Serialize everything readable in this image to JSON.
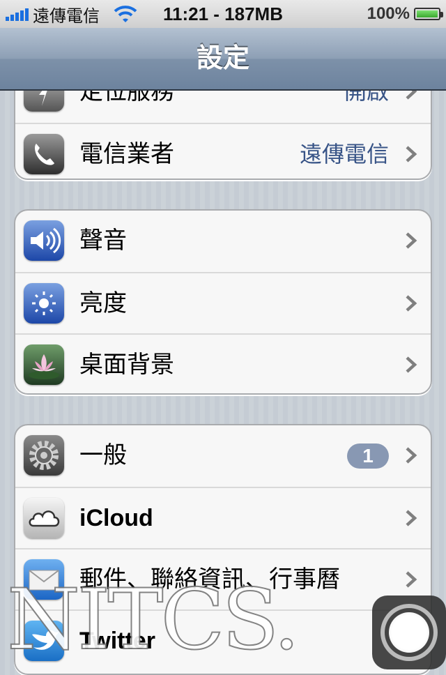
{
  "status_bar": {
    "carrier": "遠傳電信",
    "time_memory": "11:21 - 187MB",
    "battery": "100%",
    "battery_level": 1.0,
    "signal_bars": 5
  },
  "nav": {
    "title": "設定"
  },
  "groups": [
    {
      "rows": [
        {
          "label": "定位服務",
          "value": "開啟",
          "icon": "location-icon"
        },
        {
          "label": "電信業者",
          "value": "遠傳電信",
          "icon": "phone-icon"
        }
      ]
    },
    {
      "rows": [
        {
          "label": "聲音",
          "icon": "speaker-icon"
        },
        {
          "label": "亮度",
          "icon": "brightness-icon"
        },
        {
          "label": "桌面背景",
          "icon": "wallpaper-icon"
        }
      ]
    },
    {
      "rows": [
        {
          "label": "一般",
          "badge": "1",
          "icon": "gear-icon"
        },
        {
          "label": "iCloud",
          "icon": "cloud-icon"
        },
        {
          "label": "郵件、聯絡資訊、行事曆",
          "icon": "mail-icon"
        },
        {
          "label": "Twitter",
          "icon": "twitter-icon"
        }
      ]
    }
  ],
  "watermark": "NITCS.",
  "colors": {
    "value_blue": "#385487",
    "badge": "#8898b3",
    "nav": "#6d839e"
  }
}
